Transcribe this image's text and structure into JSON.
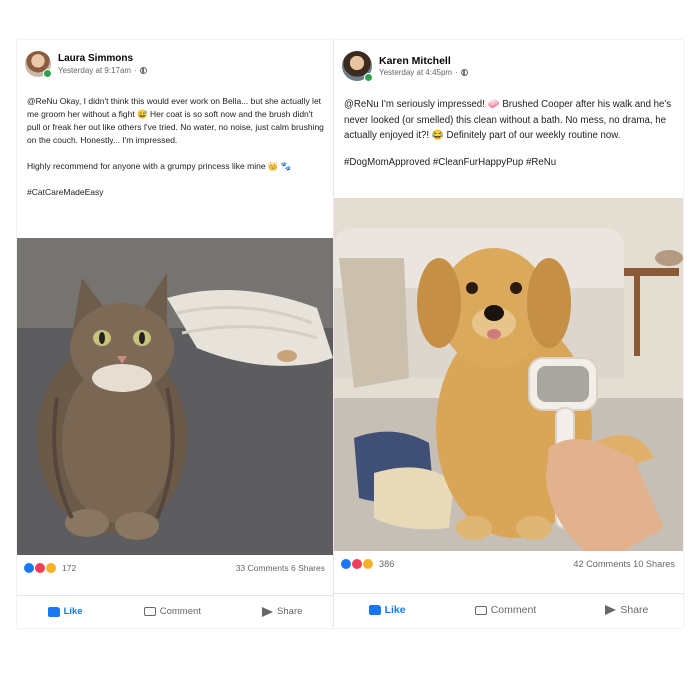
{
  "posts": [
    {
      "author": "Laura Simmons",
      "time": "Yesterday at 9:17am",
      "paragraphs": [
        "@ReNu Okay, I didn't think this would ever work on Bella... but she actually let me groom her without a fight 😅 Her coat is so soft now and the brush didn't pull or freak her out like others I've tried. No water, no noise, just calm brushing on the couch. Honestly... I'm impressed.",
        "Highly recommend for anyone with a grumpy princess like mine 👑 🐾",
        "#CatCareMadeEasy"
      ],
      "reaction_count": "172",
      "engagement": "33 Comments 6 Shares",
      "photo_subject": "tabby cat on grey couch",
      "actions": {
        "like": "Like",
        "comment": "Comment",
        "share": "Share"
      }
    },
    {
      "author": "Karen Mitchell",
      "time": "Yesterday at 4:45pm",
      "paragraphs": [
        "@ReNu I'm seriously impressed! 🧼 Brushed Cooper after his walk and he's never looked (or smelled) this clean without a bath. No mess, no drama, he actually enjoyed it?! 😂 Definitely part of our weekly routine now.",
        "#DogMomApproved #CleanFurHappyPup #ReNu"
      ],
      "reaction_count": "386",
      "engagement": "42 Comments 10 Shares",
      "photo_subject": "golden retriever with grooming brush",
      "actions": {
        "like": "Like",
        "comment": "Comment",
        "share": "Share"
      }
    }
  ],
  "colors": {
    "accent": "#1877f2",
    "online": "#31a24c",
    "muted": "#65676b"
  }
}
